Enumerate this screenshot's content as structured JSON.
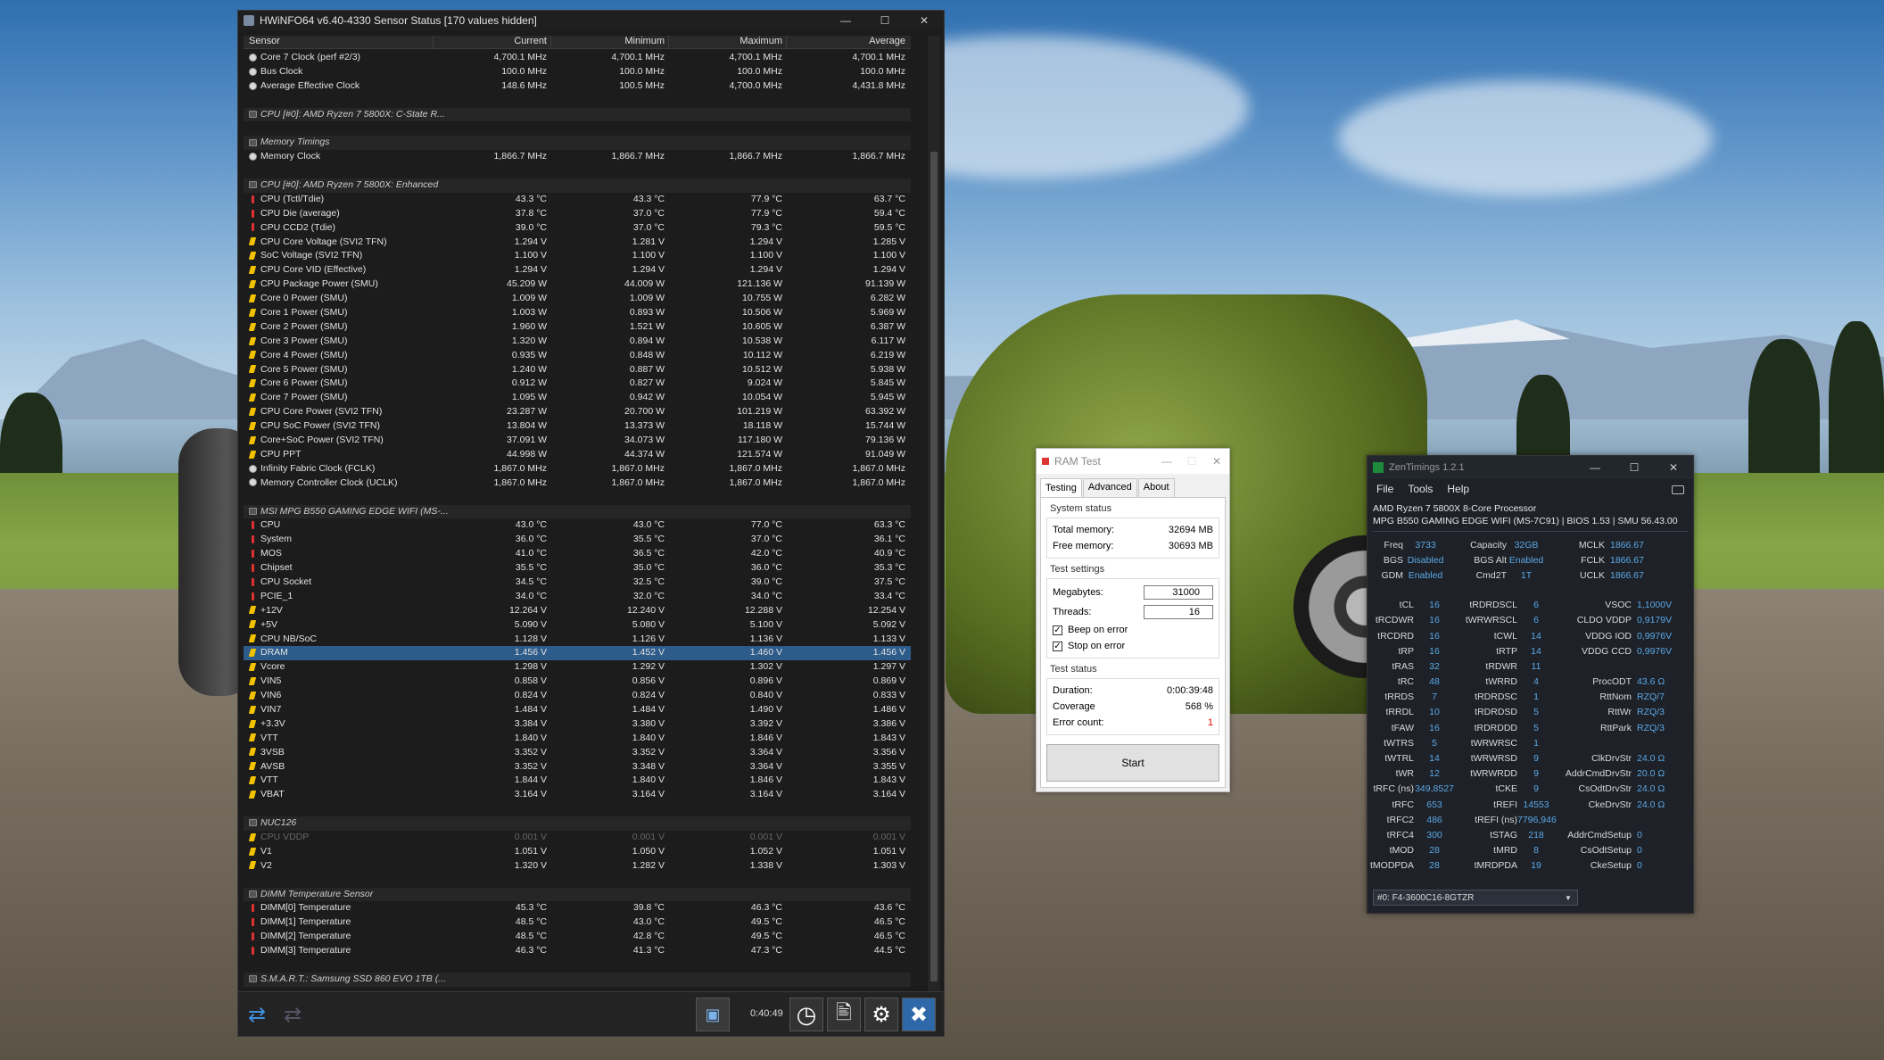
{
  "hwinfo": {
    "title": "HWiNFO64 v6.40-4330 Sensor Status [170 values hidden]",
    "columns": [
      "Sensor",
      "Current",
      "Minimum",
      "Maximum",
      "Average"
    ],
    "elapsed": "0:40:49",
    "rows": [
      {
        "t": "clock",
        "n": "Core 7 Clock (perf #2/3)",
        "c": "4,700.1 MHz",
        "mi": "4,700.1 MHz",
        "ma": "4,700.1 MHz",
        "av": "4,700.1 MHz"
      },
      {
        "t": "clock",
        "n": "Bus Clock",
        "c": "100.0 MHz",
        "mi": "100.0 MHz",
        "ma": "100.0 MHz",
        "av": "100.0 MHz"
      },
      {
        "t": "clock",
        "n": "Average Effective Clock",
        "c": "148.6 MHz",
        "mi": "100.5 MHz",
        "ma": "4,700.0 MHz",
        "av": "4,431.8 MHz"
      },
      {
        "t": "blank"
      },
      {
        "t": "grp",
        "n": "CPU [#0]: AMD Ryzen 7 5800X: C-State R..."
      },
      {
        "t": "blank"
      },
      {
        "t": "grp",
        "n": "Memory Timings"
      },
      {
        "t": "clock",
        "n": "Memory Clock",
        "c": "1,866.7 MHz",
        "mi": "1,866.7 MHz",
        "ma": "1,866.7 MHz",
        "av": "1,866.7 MHz"
      },
      {
        "t": "blank"
      },
      {
        "t": "grp",
        "n": "CPU [#0]: AMD Ryzen 7 5800X: Enhanced"
      },
      {
        "t": "temp",
        "n": "CPU (Tctl/Tdie)",
        "c": "43.3 °C",
        "mi": "43.3 °C",
        "ma": "77.9 °C",
        "av": "63.7 °C"
      },
      {
        "t": "temp",
        "n": "CPU Die (average)",
        "c": "37.8 °C",
        "mi": "37.0 °C",
        "ma": "77.9 °C",
        "av": "59.4 °C"
      },
      {
        "t": "temp",
        "n": "CPU CCD2 (Tdie)",
        "c": "39.0 °C",
        "mi": "37.0 °C",
        "ma": "79.3 °C",
        "av": "59.5 °C"
      },
      {
        "t": "bolt",
        "n": "CPU Core Voltage (SVI2 TFN)",
        "c": "1.294 V",
        "mi": "1.281 V",
        "ma": "1.294 V",
        "av": "1.285 V"
      },
      {
        "t": "bolt",
        "n": "SoC Voltage (SVI2 TFN)",
        "c": "1.100 V",
        "mi": "1.100 V",
        "ma": "1.100 V",
        "av": "1.100 V"
      },
      {
        "t": "bolt",
        "n": "CPU Core VID (Effective)",
        "c": "1.294 V",
        "mi": "1.294 V",
        "ma": "1.294 V",
        "av": "1.294 V"
      },
      {
        "t": "bolt",
        "n": "CPU Package Power (SMU)",
        "c": "45.209 W",
        "mi": "44.009 W",
        "ma": "121.136 W",
        "av": "91.139 W"
      },
      {
        "t": "bolt",
        "n": "Core 0 Power (SMU)",
        "c": "1.009 W",
        "mi": "1.009 W",
        "ma": "10.755 W",
        "av": "6.282 W"
      },
      {
        "t": "bolt",
        "n": "Core 1 Power (SMU)",
        "c": "1.003 W",
        "mi": "0.893 W",
        "ma": "10.506 W",
        "av": "5.969 W"
      },
      {
        "t": "bolt",
        "n": "Core 2 Power (SMU)",
        "c": "1.960 W",
        "mi": "1.521 W",
        "ma": "10.605 W",
        "av": "6.387 W"
      },
      {
        "t": "bolt",
        "n": "Core 3 Power (SMU)",
        "c": "1.320 W",
        "mi": "0.894 W",
        "ma": "10.538 W",
        "av": "6.117 W"
      },
      {
        "t": "bolt",
        "n": "Core 4 Power (SMU)",
        "c": "0.935 W",
        "mi": "0.848 W",
        "ma": "10.112 W",
        "av": "6.219 W"
      },
      {
        "t": "bolt",
        "n": "Core 5 Power (SMU)",
        "c": "1.240 W",
        "mi": "0.887 W",
        "ma": "10.512 W",
        "av": "5.938 W"
      },
      {
        "t": "bolt",
        "n": "Core 6 Power (SMU)",
        "c": "0.912 W",
        "mi": "0.827 W",
        "ma": "9.024 W",
        "av": "5.845 W"
      },
      {
        "t": "bolt",
        "n": "Core 7 Power (SMU)",
        "c": "1.095 W",
        "mi": "0.942 W",
        "ma": "10.054 W",
        "av": "5.945 W"
      },
      {
        "t": "bolt",
        "n": "CPU Core Power (SVI2 TFN)",
        "c": "23.287 W",
        "mi": "20.700 W",
        "ma": "101.219 W",
        "av": "63.392 W"
      },
      {
        "t": "bolt",
        "n": "CPU SoC Power (SVI2 TFN)",
        "c": "13.804 W",
        "mi": "13.373 W",
        "ma": "18.118 W",
        "av": "15.744 W"
      },
      {
        "t": "bolt",
        "n": "Core+SoC Power (SVI2 TFN)",
        "c": "37.091 W",
        "mi": "34.073 W",
        "ma": "117.180 W",
        "av": "79.136 W"
      },
      {
        "t": "bolt",
        "n": "CPU PPT",
        "c": "44.998 W",
        "mi": "44.374 W",
        "ma": "121.574 W",
        "av": "91.049 W"
      },
      {
        "t": "clock",
        "n": "Infinity Fabric Clock (FCLK)",
        "c": "1,867.0 MHz",
        "mi": "1,867.0 MHz",
        "ma": "1,867.0 MHz",
        "av": "1,867.0 MHz"
      },
      {
        "t": "clock",
        "n": "Memory Controller Clock (UCLK)",
        "c": "1,867.0 MHz",
        "mi": "1,867.0 MHz",
        "ma": "1,867.0 MHz",
        "av": "1,867.0 MHz"
      },
      {
        "t": "blank"
      },
      {
        "t": "grp",
        "n": "MSI MPG B550 GAMING EDGE WIFI (MS-..."
      },
      {
        "t": "temp",
        "n": "CPU",
        "c": "43.0 °C",
        "mi": "43.0 °C",
        "ma": "77.0 °C",
        "av": "63.3 °C"
      },
      {
        "t": "temp",
        "n": "System",
        "c": "36.0 °C",
        "mi": "35.5 °C",
        "ma": "37.0 °C",
        "av": "36.1 °C"
      },
      {
        "t": "temp",
        "n": "MOS",
        "c": "41.0 °C",
        "mi": "36.5 °C",
        "ma": "42.0 °C",
        "av": "40.9 °C"
      },
      {
        "t": "temp",
        "n": "Chipset",
        "c": "35.5 °C",
        "mi": "35.0 °C",
        "ma": "36.0 °C",
        "av": "35.3 °C"
      },
      {
        "t": "temp",
        "n": "CPU Socket",
        "c": "34.5 °C",
        "mi": "32.5 °C",
        "ma": "39.0 °C",
        "av": "37.5 °C"
      },
      {
        "t": "temp",
        "n": "PCIE_1",
        "c": "34.0 °C",
        "mi": "32.0 °C",
        "ma": "34.0 °C",
        "av": "33.4 °C"
      },
      {
        "t": "bolt",
        "n": "+12V",
        "c": "12.264 V",
        "mi": "12.240 V",
        "ma": "12.288 V",
        "av": "12.254 V"
      },
      {
        "t": "bolt",
        "n": "+5V",
        "c": "5.090 V",
        "mi": "5.080 V",
        "ma": "5.100 V",
        "av": "5.092 V"
      },
      {
        "t": "bolt",
        "n": "CPU NB/SoC",
        "c": "1.128 V",
        "mi": "1.126 V",
        "ma": "1.136 V",
        "av": "1.133 V"
      },
      {
        "t": "bolt",
        "n": "DRAM",
        "c": "1.456 V",
        "mi": "1.452 V",
        "ma": "1.460 V",
        "av": "1.456 V",
        "sel": true
      },
      {
        "t": "bolt",
        "n": "Vcore",
        "c": "1.298 V",
        "mi": "1.292 V",
        "ma": "1.302 V",
        "av": "1.297 V"
      },
      {
        "t": "bolt",
        "n": "VIN5",
        "c": "0.858 V",
        "mi": "0.856 V",
        "ma": "0.896 V",
        "av": "0.869 V"
      },
      {
        "t": "bolt",
        "n": "VIN6",
        "c": "0.824 V",
        "mi": "0.824 V",
        "ma": "0.840 V",
        "av": "0.833 V"
      },
      {
        "t": "bolt",
        "n": "VIN7",
        "c": "1.484 V",
        "mi": "1.484 V",
        "ma": "1.490 V",
        "av": "1.486 V"
      },
      {
        "t": "bolt",
        "n": "+3.3V",
        "c": "3.384 V",
        "mi": "3.380 V",
        "ma": "3.392 V",
        "av": "3.386 V"
      },
      {
        "t": "bolt",
        "n": "VTT",
        "c": "1.840 V",
        "mi": "1.840 V",
        "ma": "1.846 V",
        "av": "1.843 V"
      },
      {
        "t": "bolt",
        "n": "3VSB",
        "c": "3.352 V",
        "mi": "3.352 V",
        "ma": "3.364 V",
        "av": "3.356 V"
      },
      {
        "t": "bolt",
        "n": "AVSB",
        "c": "3.352 V",
        "mi": "3.348 V",
        "ma": "3.364 V",
        "av": "3.355 V"
      },
      {
        "t": "bolt",
        "n": "VTT",
        "c": "1.844 V",
        "mi": "1.840 V",
        "ma": "1.846 V",
        "av": "1.843 V"
      },
      {
        "t": "bolt",
        "n": "VBAT",
        "c": "3.164 V",
        "mi": "3.164 V",
        "ma": "3.164 V",
        "av": "3.164 V"
      },
      {
        "t": "blank"
      },
      {
        "t": "grp",
        "n": "NUC126"
      },
      {
        "t": "bolt",
        "n": "CPU VDDP",
        "c": "0.001 V",
        "mi": "0.001 V",
        "ma": "0.001 V",
        "av": "0.001 V",
        "dim": true
      },
      {
        "t": "bolt",
        "n": "V1",
        "c": "1.051 V",
        "mi": "1.050 V",
        "ma": "1.052 V",
        "av": "1.051 V"
      },
      {
        "t": "bolt",
        "n": "V2",
        "c": "1.320 V",
        "mi": "1.282 V",
        "ma": "1.338 V",
        "av": "1.303 V"
      },
      {
        "t": "blank"
      },
      {
        "t": "grp",
        "n": "DIMM Temperature Sensor"
      },
      {
        "t": "temp",
        "n": "DIMM[0] Temperature",
        "c": "45.3 °C",
        "mi": "39.8 °C",
        "ma": "46.3 °C",
        "av": "43.6 °C"
      },
      {
        "t": "temp",
        "n": "DIMM[1] Temperature",
        "c": "48.5 °C",
        "mi": "43.0 °C",
        "ma": "49.5 °C",
        "av": "46.5 °C"
      },
      {
        "t": "temp",
        "n": "DIMM[2] Temperature",
        "c": "48.5 °C",
        "mi": "42.8 °C",
        "ma": "49.5 °C",
        "av": "46.5 °C"
      },
      {
        "t": "temp",
        "n": "DIMM[3] Temperature",
        "c": "46.3 °C",
        "mi": "41.3 °C",
        "ma": "47.3 °C",
        "av": "44.5 °C"
      },
      {
        "t": "blank"
      },
      {
        "t": "grp",
        "n": "S.M.A.R.T.: Samsung SSD 860 EVO 1TB (..."
      }
    ]
  },
  "ramtest": {
    "title": "RAM Test",
    "tabs": [
      "Testing",
      "Advanced",
      "About"
    ],
    "system_status": "System status",
    "total_label": "Total memory:",
    "total_value": "32694 MB",
    "free_label": "Free memory:",
    "free_value": "30693 MB",
    "test_settings": "Test settings",
    "mb_label": "Megabytes:",
    "mb_value": "31000",
    "threads_label": "Threads:",
    "threads_value": "16",
    "beep_label": "Beep on error",
    "stop_label": "Stop on error",
    "test_status": "Test status",
    "duration_label": "Duration:",
    "duration_value": "0:00:39:48",
    "coverage_label": "Coverage",
    "coverage_value": "568 %",
    "errors_label": "Error count:",
    "errors_value": "1",
    "start_label": "Start"
  },
  "zentimings": {
    "title": "ZenTimings 1.2.1",
    "menu": [
      "File",
      "Tools",
      "Help"
    ],
    "cpu": "AMD Ryzen 7 5800X 8-Core Processor",
    "board": "MPG B550 GAMING EDGE WIFI (MS-7C91) | BIOS 1.53 | SMU 56.43.00",
    "top": [
      [
        "Freq",
        "3733",
        "Capacity",
        "32GB",
        "MCLK",
        "1866.67"
      ],
      [
        "BGS",
        "Disabled",
        "BGS Alt",
        "Enabled",
        "FCLK",
        "1866.67"
      ],
      [
        "GDM",
        "Enabled",
        "Cmd2T",
        "1T",
        "UCLK",
        "1866.67"
      ]
    ],
    "timings": [
      [
        "tCL",
        "16",
        "tRDRDSCL",
        "6",
        "VSOC",
        "1,1000V"
      ],
      [
        "tRCDWR",
        "16",
        "tWRWRSCL",
        "6",
        "CLDO VDDP",
        "0,9179V"
      ],
      [
        "tRCDRD",
        "16",
        "tCWL",
        "14",
        "VDDG IOD",
        "0,9976V"
      ],
      [
        "tRP",
        "16",
        "tRTP",
        "14",
        "VDDG CCD",
        "0,9976V"
      ],
      [
        "tRAS",
        "32",
        "tRDWR",
        "11",
        "",
        ""
      ],
      [
        "tRC",
        "48",
        "tWRRD",
        "4",
        "ProcODT",
        "43.6 Ω"
      ],
      [
        "tRRDS",
        "7",
        "tRDRDSC",
        "1",
        "RttNom",
        "RZQ/7"
      ],
      [
        "tRRDL",
        "10",
        "tRDRDSD",
        "5",
        "RttWr",
        "RZQ/3"
      ],
      [
        "tFAW",
        "16",
        "tRDRDDD",
        "5",
        "RttPark",
        "RZQ/3"
      ],
      [
        "tWTRS",
        "5",
        "tWRWRSC",
        "1",
        "",
        ""
      ],
      [
        "tWTRL",
        "14",
        "tWRWRSD",
        "9",
        "ClkDrvStr",
        "24.0 Ω"
      ],
      [
        "tWR",
        "12",
        "tWRWRDD",
        "9",
        "AddrCmdDrvStr",
        "20.0 Ω"
      ],
      [
        "tRFC (ns)",
        "349,8527",
        "tCKE",
        "9",
        "CsOdtDrvStr",
        "24.0 Ω"
      ],
      [
        "tRFC",
        "653",
        "tREFI",
        "14553",
        "CkeDrvStr",
        "24.0 Ω"
      ],
      [
        "tRFC2",
        "486",
        "tREFI (ns)",
        "7796,946",
        "",
        ""
      ],
      [
        "tRFC4",
        "300",
        "tSTAG",
        "218",
        "AddrCmdSetup",
        "0"
      ],
      [
        "tMOD",
        "28",
        "tMRD",
        "8",
        "CsOdtSetup",
        "0"
      ],
      [
        "tMODPDA",
        "28",
        "tMRDPDA",
        "19",
        "CkeSetup",
        "0"
      ]
    ],
    "module": "#0: F4-3600C16-8GTZR"
  }
}
